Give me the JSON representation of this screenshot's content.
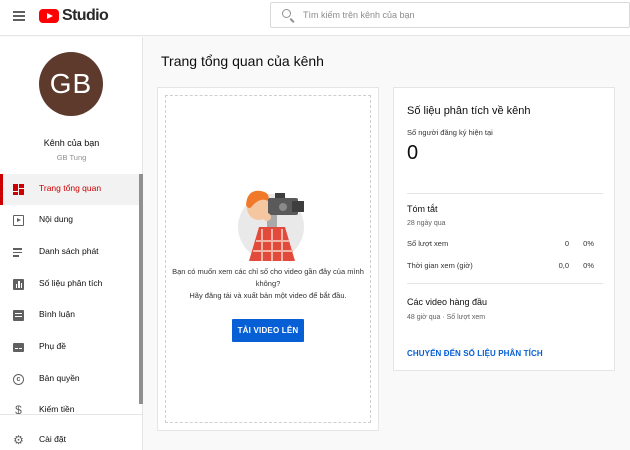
{
  "header": {
    "brand_text": "Studio",
    "search_placeholder": "Tìm kiếm trên kênh của bạn",
    "brand_color": "#ff0000"
  },
  "sidebar": {
    "avatar_initials": "GB",
    "avatar_color": "#5d3a2c",
    "channel_label": "Kênh của bạn",
    "channel_name": "GB Tung",
    "items": [
      {
        "label": "Trang tổng quan",
        "icon": "dashboard-icon",
        "active": true
      },
      {
        "label": "Nội dung",
        "icon": "content-icon"
      },
      {
        "label": "Danh sách phát",
        "icon": "playlist-icon"
      },
      {
        "label": "Số liệu phân tích",
        "icon": "analytics-icon"
      },
      {
        "label": "Bình luận",
        "icon": "comments-icon"
      },
      {
        "label": "Phụ đề",
        "icon": "subtitles-icon"
      },
      {
        "label": "Bản quyền",
        "icon": "copyright-icon"
      },
      {
        "label": "Kiếm tiền",
        "icon": "monetization-icon"
      }
    ],
    "settings_label": "Cài đặt",
    "active_color": "#cc0000"
  },
  "main": {
    "title": "Trang tổng quan của kênh",
    "upload_card": {
      "line1": "Bạn có muốn xem các chỉ số cho video gần đây của mình không?",
      "line2": "Hãy đăng tải và xuất bản một video để bắt đầu.",
      "button": "TẢI VIDEO LÊN",
      "button_color": "#065fd4"
    },
    "analytics_card": {
      "title": "Số liệu phân tích về kênh",
      "subscribers_label": "Số người đăng ký hiện tại",
      "subscribers_value": "0",
      "summary_title": "Tóm tắt",
      "summary_period": "28 ngày qua",
      "rows": [
        {
          "label": "Số lượt xem",
          "value": "0",
          "change": "0%"
        },
        {
          "label": "Thời gian xem (giờ)",
          "value": "0,0",
          "change": "0%"
        }
      ],
      "top_videos_title": "Các video hàng đầu",
      "top_videos_sub": "48 giờ qua · Số lượt xem",
      "link": "CHUYỂN ĐẾN SỐ LIỆU PHÂN TÍCH",
      "link_color": "#065fd4"
    }
  }
}
